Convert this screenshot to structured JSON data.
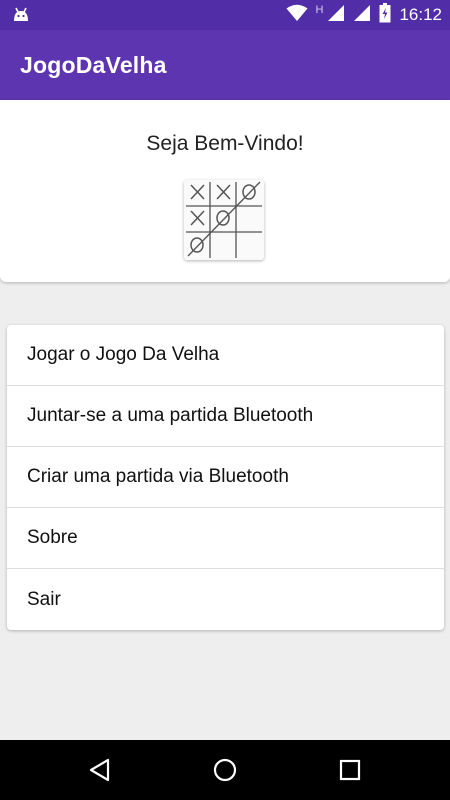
{
  "status_bar": {
    "time": "16:12",
    "network_label": "H",
    "icons": [
      "android-icon",
      "wifi-icon",
      "signal-icon",
      "signal-icon",
      "battery-charging-icon"
    ]
  },
  "app_bar": {
    "title": "JogoDaVelha",
    "color": "#5e35b1"
  },
  "welcome": {
    "text": "Seja Bem-Vindo!",
    "logo_icon": "tic-tac-toe-logo"
  },
  "menu": {
    "items": [
      {
        "label": "Jogar o Jogo Da Velha"
      },
      {
        "label": "Juntar-se a uma partida Bluetooth"
      },
      {
        "label": "Criar uma partida via Bluetooth"
      },
      {
        "label": "Sobre"
      },
      {
        "label": "Sair"
      }
    ]
  },
  "nav_bar": {
    "icons": [
      "back-icon",
      "home-icon",
      "recents-icon"
    ]
  },
  "colors": {
    "status_bar": "#512da8",
    "app_bar": "#5e35b1",
    "background": "#eeeeee"
  }
}
